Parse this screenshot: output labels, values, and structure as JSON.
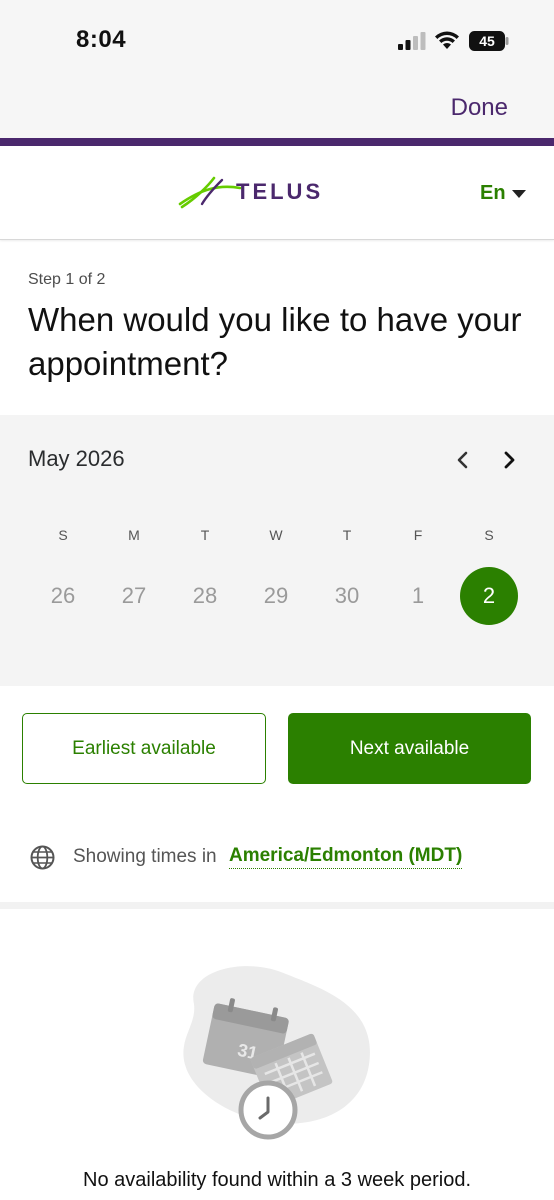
{
  "status_bar": {
    "time": "8:04",
    "battery": "45"
  },
  "browser": {
    "done_label": "Done"
  },
  "header": {
    "logo_text": "TELUS",
    "language": "En"
  },
  "booking": {
    "step": "Step 1 of 2",
    "title": "When would you like to have your appointment?"
  },
  "calendar": {
    "month_label": "May 2026",
    "weekdays": [
      "S",
      "M",
      "T",
      "W",
      "T",
      "F",
      "S"
    ],
    "days": [
      "26",
      "27",
      "28",
      "29",
      "30",
      "1",
      "2"
    ],
    "selected_day": "2"
  },
  "actions": {
    "earliest_label": "Earliest available",
    "next_label": "Next available"
  },
  "timezone": {
    "prefix": "Showing times in",
    "zone": "America/Edmonton (MDT)"
  },
  "empty_state": {
    "message": "No availability found within a 3 week period.",
    "illustration_date": "31"
  },
  "colors": {
    "brand_purple": "#4b286d",
    "brand_green": "#2b8000",
    "calendar_bg": "#f4f4f4"
  }
}
